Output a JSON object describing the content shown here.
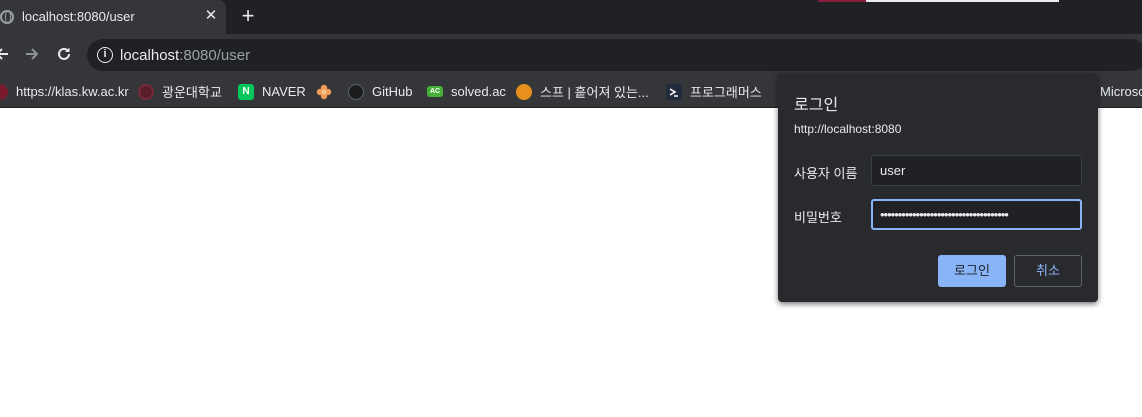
{
  "tab": {
    "title": "localhost:8080/user",
    "close_glyph": "✕",
    "new_tab_glyph": "+"
  },
  "toolbar": {
    "back_icon": "arrow-left-icon",
    "forward_icon": "arrow-right-icon",
    "reload_icon": "reload-icon",
    "info_glyph": "i",
    "url_host": "localhost",
    "url_rest": ":8080/user"
  },
  "bookmarks": [
    {
      "label": "https://klas.kw.ac.kr",
      "icon": "klas-icon"
    },
    {
      "label": "광운대학교",
      "icon": "kwangwoon-icon"
    },
    {
      "label": "NAVER",
      "icon": "naver-icon",
      "glyph": "N",
      "color": "#03c75a"
    },
    {
      "label": "",
      "icon": "flower-icon"
    },
    {
      "label": "GitHub",
      "icon": "github-icon"
    },
    {
      "label": "solved.ac",
      "icon": "solved-ac-icon",
      "glyph": "AC",
      "color": "#45b035"
    },
    {
      "label": "스프 | 흩어져 있는...",
      "icon": "spp-icon"
    },
    {
      "label": "프로그래머스",
      "icon": "programmers-icon"
    },
    {
      "label": "Microso",
      "icon": ""
    }
  ],
  "dialog": {
    "title": "로그인",
    "origin": "http://localhost:8080",
    "username_label": "사용자 이름",
    "username_value": "user",
    "password_label": "비밀번호",
    "password_value": "••••••••••••••••••••••••••••••••••••",
    "login_button": "로그인",
    "cancel_button": "취소"
  },
  "colors": {
    "chrome_dark": "#202124",
    "chrome_toolbar": "#35363a",
    "dialog_bg": "#292a2d",
    "accent_blue": "#8ab4f8"
  }
}
